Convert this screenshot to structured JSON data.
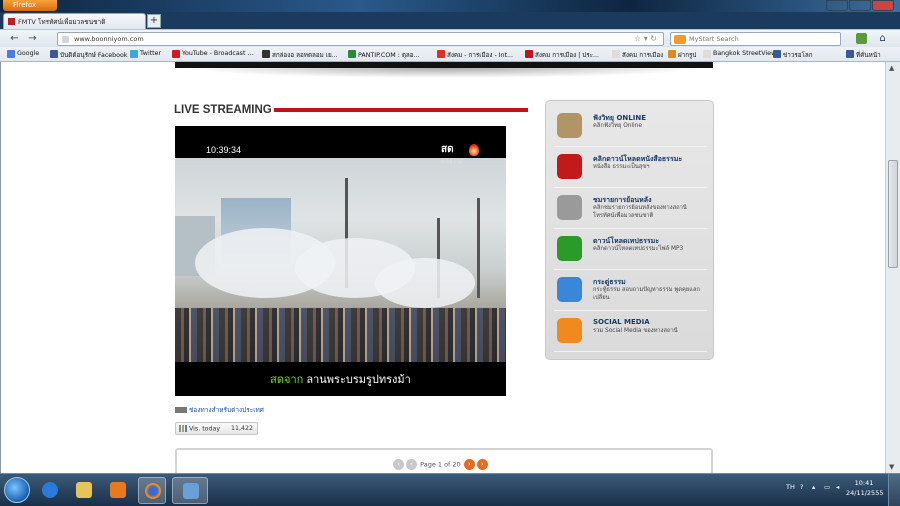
{
  "browser": {
    "app_button": "Firefox",
    "tab_title": "FMTV โทรทัศน์เพื่อมวลชนชาติ",
    "new_tab": "+",
    "url": "www.boonniyom.com",
    "search_placeholder": "MyStart Search"
  },
  "bookmarks": [
    {
      "label": "Google",
      "icon_color": "#4a7be0"
    },
    {
      "label": "บันดิต์อนุรักษ์ Facebook",
      "icon_color": "#3b5998"
    },
    {
      "label": "Twitter",
      "icon_color": "#3fa7e0"
    },
    {
      "label": "YouTube - Broadcast ...",
      "icon_color": "#d21a1a"
    },
    {
      "label": "สกล่องอ ลอทตลอม เย...",
      "icon_color": "#333333"
    },
    {
      "label": "PANTIP.COM : ตุลอ...",
      "icon_color": "#2a8a3a"
    },
    {
      "label": "สังคม - การเมือง - Int...",
      "icon_color": "#e0301e"
    },
    {
      "label": "สังคม การเมือง | ประ...",
      "icon_color": "#c2121c"
    },
    {
      "label": "สังคม การเมือง",
      "icon_color": "#dddddd"
    },
    {
      "label": "ฝากรูป",
      "icon_color": "#e08a1e"
    },
    {
      "label": "Bangkok StreetView",
      "icon_color": "#dddddd"
    },
    {
      "label": "ข่าวรอโลก",
      "icon_color": "#3b5998"
    },
    {
      "label": "ที่คั่นหน้า",
      "icon_color": "#3b5998"
    }
  ],
  "page": {
    "section_title": "LIVE STREAMING",
    "video": {
      "timecode": "10:39:34",
      "logo_top": "สด",
      "logo_bottom": "FMTV",
      "caption_prefix": "สดจาก",
      "caption_location": "ลานพระบรมรูปทรงม้า"
    },
    "foreign_link": "ช่องทางสำหรับต่างประเทศ",
    "stats": {
      "label": "Vis. today",
      "value": "11,422"
    },
    "pager": {
      "text": "Page 1 of 20",
      "prev": "‹",
      "next": "›"
    }
  },
  "sidebar": {
    "items": [
      {
        "title": "ฟังวิทยุ ONLINE",
        "subtitle": "คลิกฟังวิทยุ Online",
        "icon": "radio-icon",
        "icon_color": "#b39466"
      },
      {
        "title": "คลิกดาวน์โหลดหนังสือธรรมะ",
        "subtitle": "หนังสือ ธรรมะเป็นสุขฯ",
        "icon": "pdf-icon",
        "icon_color": "#c21a1a"
      },
      {
        "title": "ชมรายการย้อนหลัง",
        "subtitle": "คลิกชมรายการย้อนหลังของทางสถานี โทรทัศน์เพื่อมวลชนชาติ",
        "icon": "film-icon",
        "icon_color": "#9a9a9a"
      },
      {
        "title": "ดาวน์โหลดเทปธรรมะ",
        "subtitle": "คลิกดาวน์โหลดเทปธรรมะไฟล์ MP3",
        "icon": "music-icon",
        "icon_color": "#2a9a2a"
      },
      {
        "title": "กระดู่ธรรม",
        "subtitle": "กระทู้ธรรม สอบถามปัญหาธรรม พูดคุยแลกเปลี่ยน",
        "icon": "chat-icon",
        "icon_color": "#3a86d8"
      },
      {
        "title": "SOCIAL MEDIA",
        "subtitle": "รวม Social Media ของทางสถานี",
        "icon": "rss-icon",
        "icon_color": "#f08a1e"
      }
    ]
  },
  "taskbar": {
    "language": "TH",
    "time": "10:41",
    "date": "24/11/2555"
  }
}
